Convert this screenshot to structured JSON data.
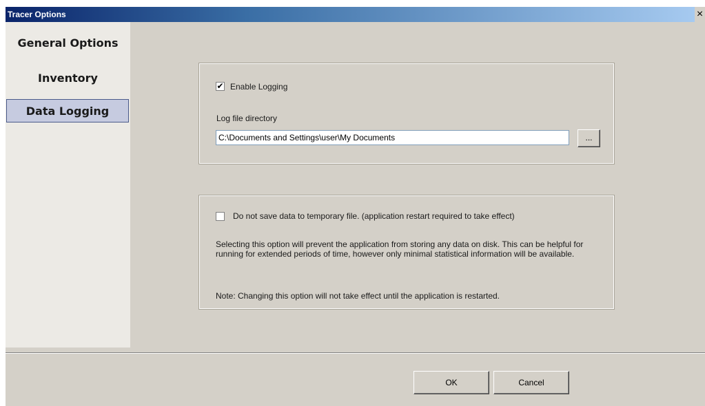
{
  "window": {
    "title": "Tracer Options",
    "close_glyph": "×"
  },
  "sidebar": {
    "items": [
      {
        "label": "General Options",
        "selected": false
      },
      {
        "label": "Inventory",
        "selected": false
      },
      {
        "label": "Data Logging",
        "selected": true
      }
    ]
  },
  "logging": {
    "enable_checkbox_label": "Enable Logging",
    "enable_checked": true,
    "check_glyph": "✔",
    "dir_label": "Log file directory",
    "dir_value": "C:\\Documents and Settings\\user\\My Documents",
    "browse_label": "..."
  },
  "temp_file": {
    "checkbox_label": "Do not save data to temporary file. (application restart required to take effect)",
    "checked": false,
    "description": "Selecting this option will prevent the application from storing any data on disk. This can be helpful for running for extended periods of time, however only minimal statistical information will be available.",
    "note": "Note: Changing this option will not take effect until the application is restarted."
  },
  "buttons": {
    "ok": "OK",
    "cancel": "Cancel"
  },
  "icons": {
    "close": "close-icon",
    "check": "check-icon",
    "browse": "ellipsis-icon"
  },
  "colors": {
    "title_gradient_start": "#0a246a",
    "title_gradient_end": "#a6caf0",
    "selected_item_bg": "#c6cbe0",
    "dialog_bg": "#d4d0c8"
  }
}
